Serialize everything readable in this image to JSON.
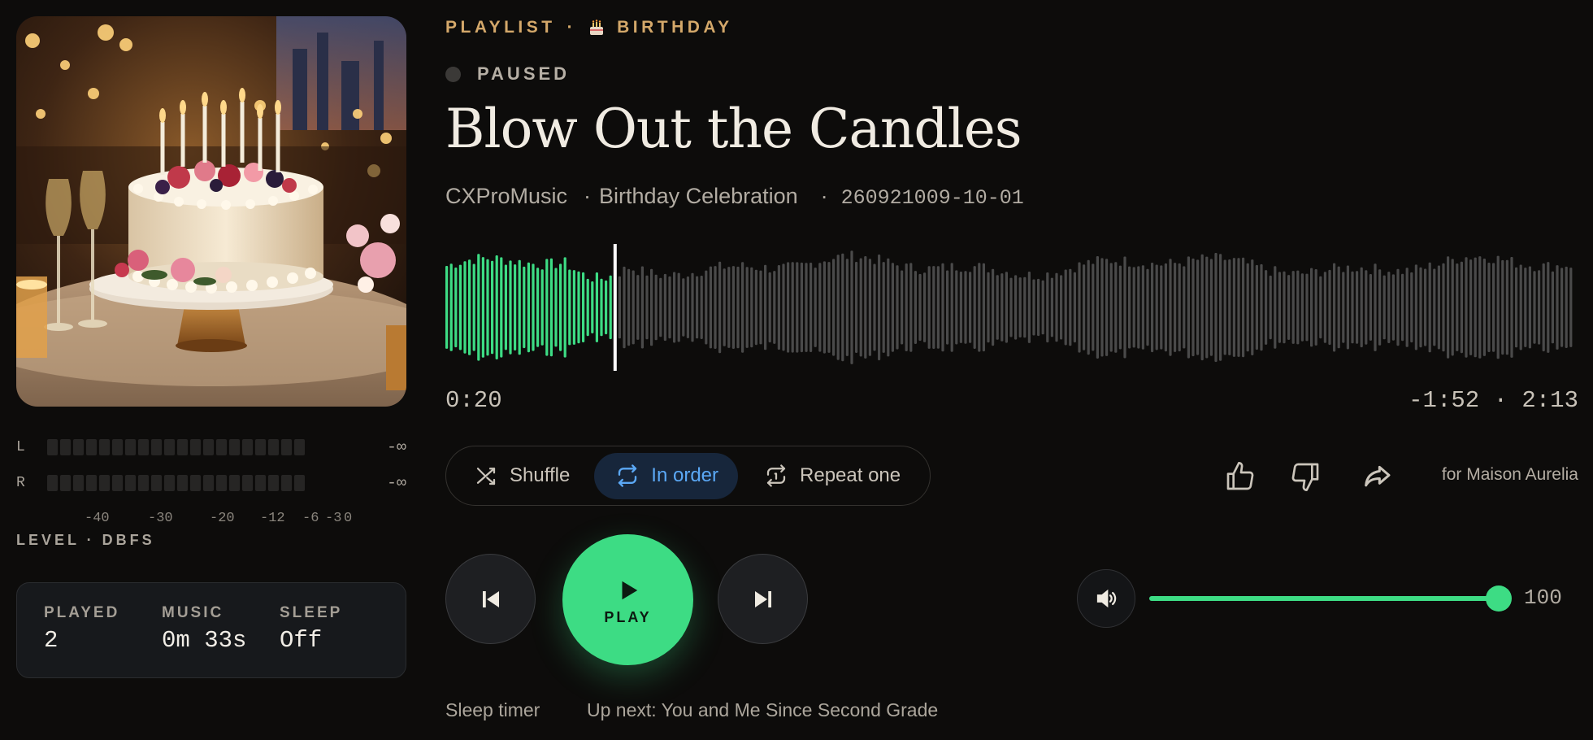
{
  "playlist": {
    "label": "PLAYLIST",
    "separator": "·",
    "name": "BIRTHDAY",
    "icon": "birthday-cake-icon"
  },
  "status": "PAUSED",
  "track": {
    "title": "Blow Out the Candles",
    "artist": "CXProMusic",
    "album": "Birthday Celebration",
    "code": "260921009-10-01",
    "separator": "·"
  },
  "progress": {
    "elapsed": "0:20",
    "remaining": "-1:52 · 2:13",
    "fraction": 0.15
  },
  "level_meter": {
    "channels": [
      {
        "label": "L",
        "value": "-∞"
      },
      {
        "label": "R",
        "value": "-∞"
      }
    ],
    "scale": [
      "-40",
      "-30",
      "-20",
      "-12",
      "-6",
      "-3",
      "0"
    ],
    "title": "LEVEL · DBFS"
  },
  "stats": [
    {
      "label": "PLAYED",
      "value": "2"
    },
    {
      "label": "MUSIC",
      "value": "0m 33s"
    },
    {
      "label": "SLEEP",
      "value": "Off"
    }
  ],
  "modes": [
    {
      "label": "Shuffle",
      "icon": "shuffle-icon",
      "active": false
    },
    {
      "label": "In order",
      "icon": "repeat-icon",
      "active": true
    },
    {
      "label": "Repeat one",
      "icon": "repeat-one-icon",
      "active": false
    }
  ],
  "actions": {
    "like_icon": "thumbs-up-icon",
    "dislike_icon": "thumbs-down-icon",
    "share_icon": "share-icon",
    "for_text": "for Maison Aurelia"
  },
  "transport": {
    "play_label": "PLAY"
  },
  "volume": {
    "value": "100",
    "level": 1.0
  },
  "footer": {
    "sleep_timer": "Sleep timer",
    "up_next": "Up next: You and Me Since Second Grade"
  },
  "colors": {
    "accent": "#3ddc84",
    "gold": "#d4a86a",
    "active_mode": "#5ba8f5",
    "background": "#0d0c0b"
  }
}
